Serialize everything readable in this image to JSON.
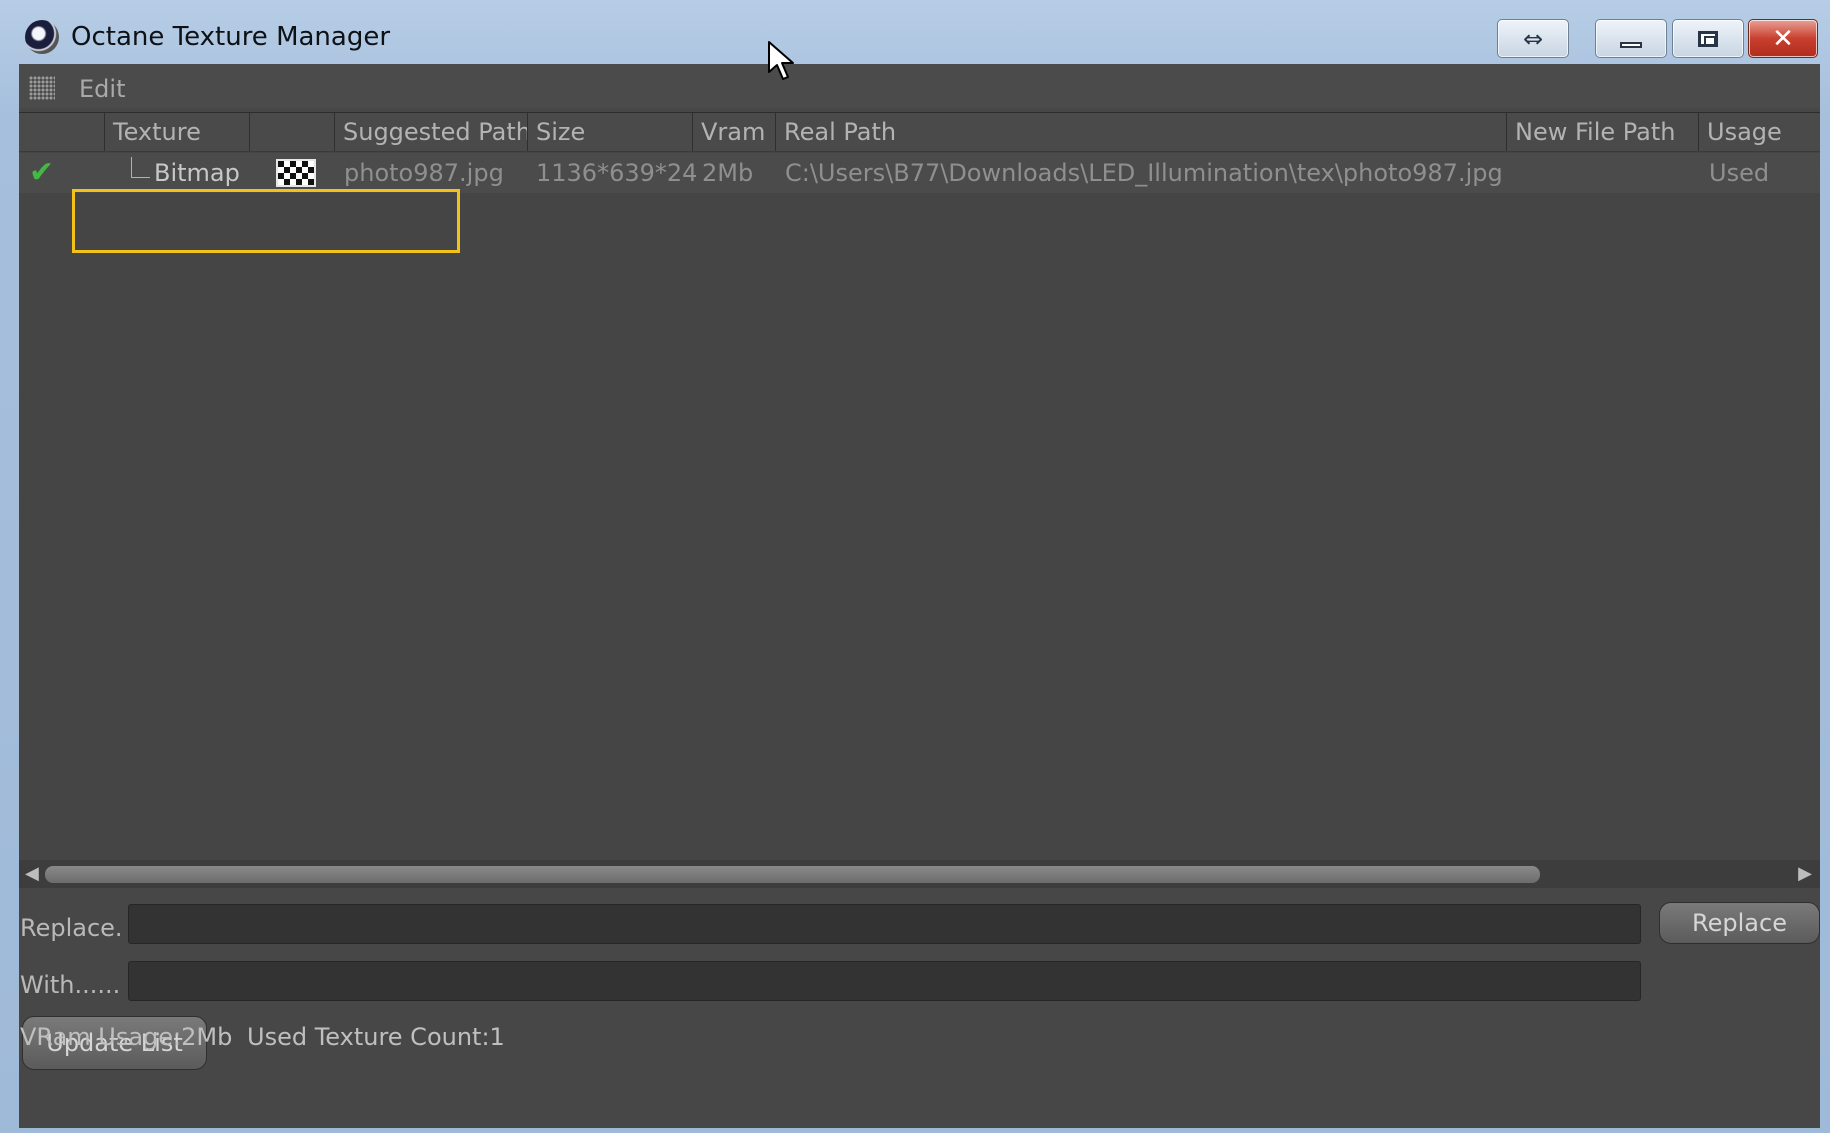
{
  "window": {
    "title": "Octane Texture Manager",
    "caption_buttons": {
      "resize_symbol": "⇔",
      "close_symbol": "✕"
    }
  },
  "menu": {
    "items": [
      {
        "label": "Edit"
      }
    ]
  },
  "table": {
    "columns": [
      "",
      "Texture",
      "",
      "Suggested Path",
      "Size",
      "Vram",
      "Real Path",
      "New File Path",
      "Usage"
    ],
    "rows": [
      {
        "status_icon": "check-icon",
        "texture": "Bitmap",
        "preview_icon": "checker-texture-icon",
        "suggested_path": "photo987.jpg",
        "size": "1136*639*24",
        "vram": "2Mb",
        "real_path": "C:\\Users\\B77\\Downloads\\LED_Illumination\\tex\\photo987.jpg",
        "new_file_path": "",
        "usage": "Used"
      }
    ]
  },
  "replace": {
    "replace_label": "Replace.",
    "with_label": "With......",
    "replace_value": "",
    "with_value": "",
    "replace_button": "Replace"
  },
  "update_button": "Update List",
  "status": {
    "vram_usage": "VRam Usage:2Mb",
    "texture_count": "Used Texture Count:1"
  },
  "colors": {
    "panel": "#474747",
    "highlight": "#f2c21b",
    "check": "#43b843"
  }
}
